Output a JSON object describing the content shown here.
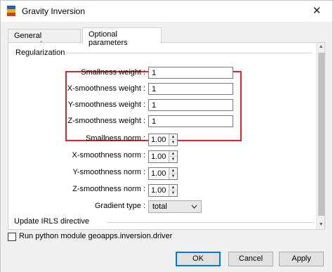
{
  "window": {
    "title": "Gravity Inversion",
    "close_glyph": "✕"
  },
  "tabs": [
    {
      "label": "General parameters",
      "active": false
    },
    {
      "label": "Optional parameters",
      "active": true
    }
  ],
  "regularization": {
    "title": "Regularization",
    "weights": [
      {
        "label": "Smallness weight :",
        "value": "1"
      },
      {
        "label": "X-smoothness weight :",
        "value": "1"
      },
      {
        "label": "Y-smoothness weight :",
        "value": "1"
      },
      {
        "label": "Z-smoothness weight :",
        "value": "1"
      }
    ],
    "norms": [
      {
        "label": "Smallness norm :",
        "value": "1.00"
      },
      {
        "label": "X-smoothness norm :",
        "value": "1.00"
      },
      {
        "label": "Y-smoothness norm :",
        "value": "1.00"
      },
      {
        "label": "Z-smoothness norm :",
        "value": "1.00"
      }
    ],
    "gradient_type": {
      "label": "Gradient type :",
      "value": "total"
    }
  },
  "next_group_title": "Update IRLS directive",
  "run_module": {
    "label": "Run python module geoapps.inversion.driver",
    "checked": false
  },
  "buttons": {
    "ok": "OK",
    "cancel": "Cancel",
    "apply": "Apply"
  },
  "colors": {
    "highlight": "#e0212e",
    "default_button_border": "#0078d7"
  },
  "icons": [
    "gravity-app-icon",
    "close-icon",
    "spin-up-icon",
    "spin-down-icon",
    "dropdown-chevron-icon",
    "scroll-up-icon",
    "scroll-down-icon"
  ]
}
